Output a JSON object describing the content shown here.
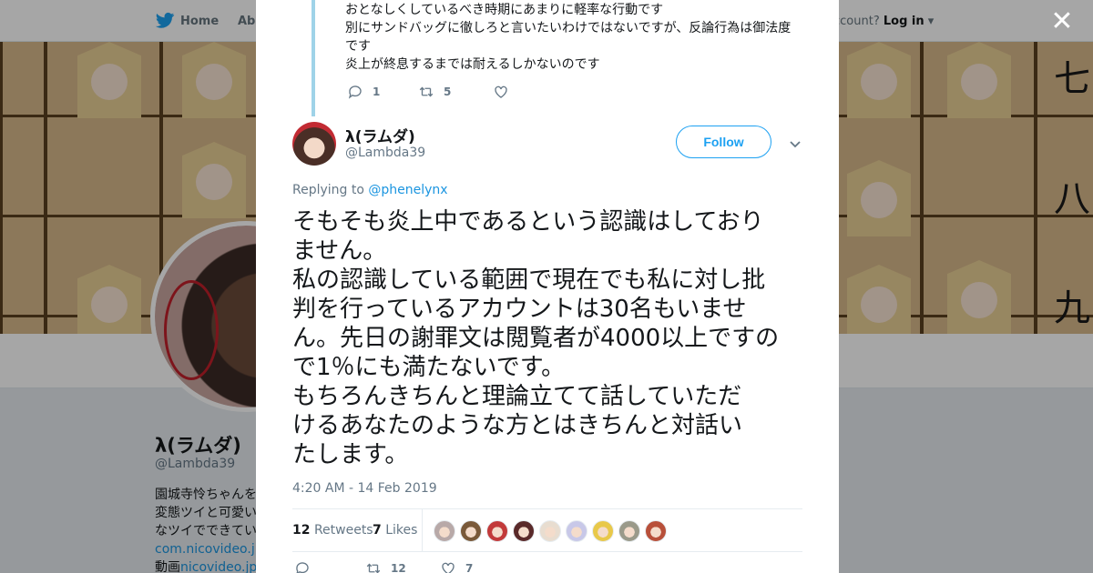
{
  "topnav": {
    "home_label": "Home",
    "about_label": "Abo",
    "account_prompt": "ccount?",
    "login_label": "Log in"
  },
  "background_profile": {
    "name": "λ(ラムダ)",
    "handle": "@Lambda39",
    "bio_lines": [
      "園城寺怜ちゃんを",
      "変態ツイと可愛い",
      "なツイでできてい"
    ],
    "bio_link1": "com.nicovideo.jp/c",
    "bio_line_prefix": "動画",
    "bio_link2": "nicovideo.jp/m",
    "header_kanji": [
      "七",
      "八",
      "九"
    ]
  },
  "prev_tweet": {
    "lines": [
      "おとなしくしているべき時期にあまりに軽率な行動です",
      "別にサンドバッグに徹しろと言いたいわけではないですが、反論行為は御法度",
      "です",
      "炎上が終息するまでは耐えるしかないのです"
    ],
    "reply_count": "1",
    "retweet_count": "5",
    "like_count": ""
  },
  "tweet": {
    "name": "λ(ラムダ)",
    "handle": "@Lambda39",
    "follow_label": "Follow",
    "replying_prefix": "Replying to",
    "replying_to": "@phenelynx",
    "text": "そもそも炎上中であるという認識はしており\nません。\n私の認識している範囲で現在でも私に対し批\n判を行っているアカウントは30名もいませ\nん。先日の謝罪文は閲覧者が4000以上ですの\nで1％にも満たないです。\nもちろんきちんと理論立てて話していただ\nけるあなたのような方とはきちんと対話い\nたします。",
    "timestamp": "4:20 AM - 14 Feb 2019",
    "retweets_count": "12",
    "retweets_label": "Retweets",
    "likes_count": "7",
    "likes_label": "Likes",
    "liker_face_colors": [
      "#b8a9a8",
      "#7a5a3a",
      "#c23a3a",
      "#5a2a2a",
      "#e8ddd0",
      "#c8c8e8",
      "#e8c84a",
      "#9a9a8a",
      "#b8503a"
    ],
    "action_reply_count": "",
    "action_retweet_count": "12",
    "action_like_count": "7"
  },
  "colors": {
    "accent": "#1da1f2",
    "link": "#1b95e0",
    "muted": "#657786",
    "thread_line": "#9fd3e8"
  }
}
